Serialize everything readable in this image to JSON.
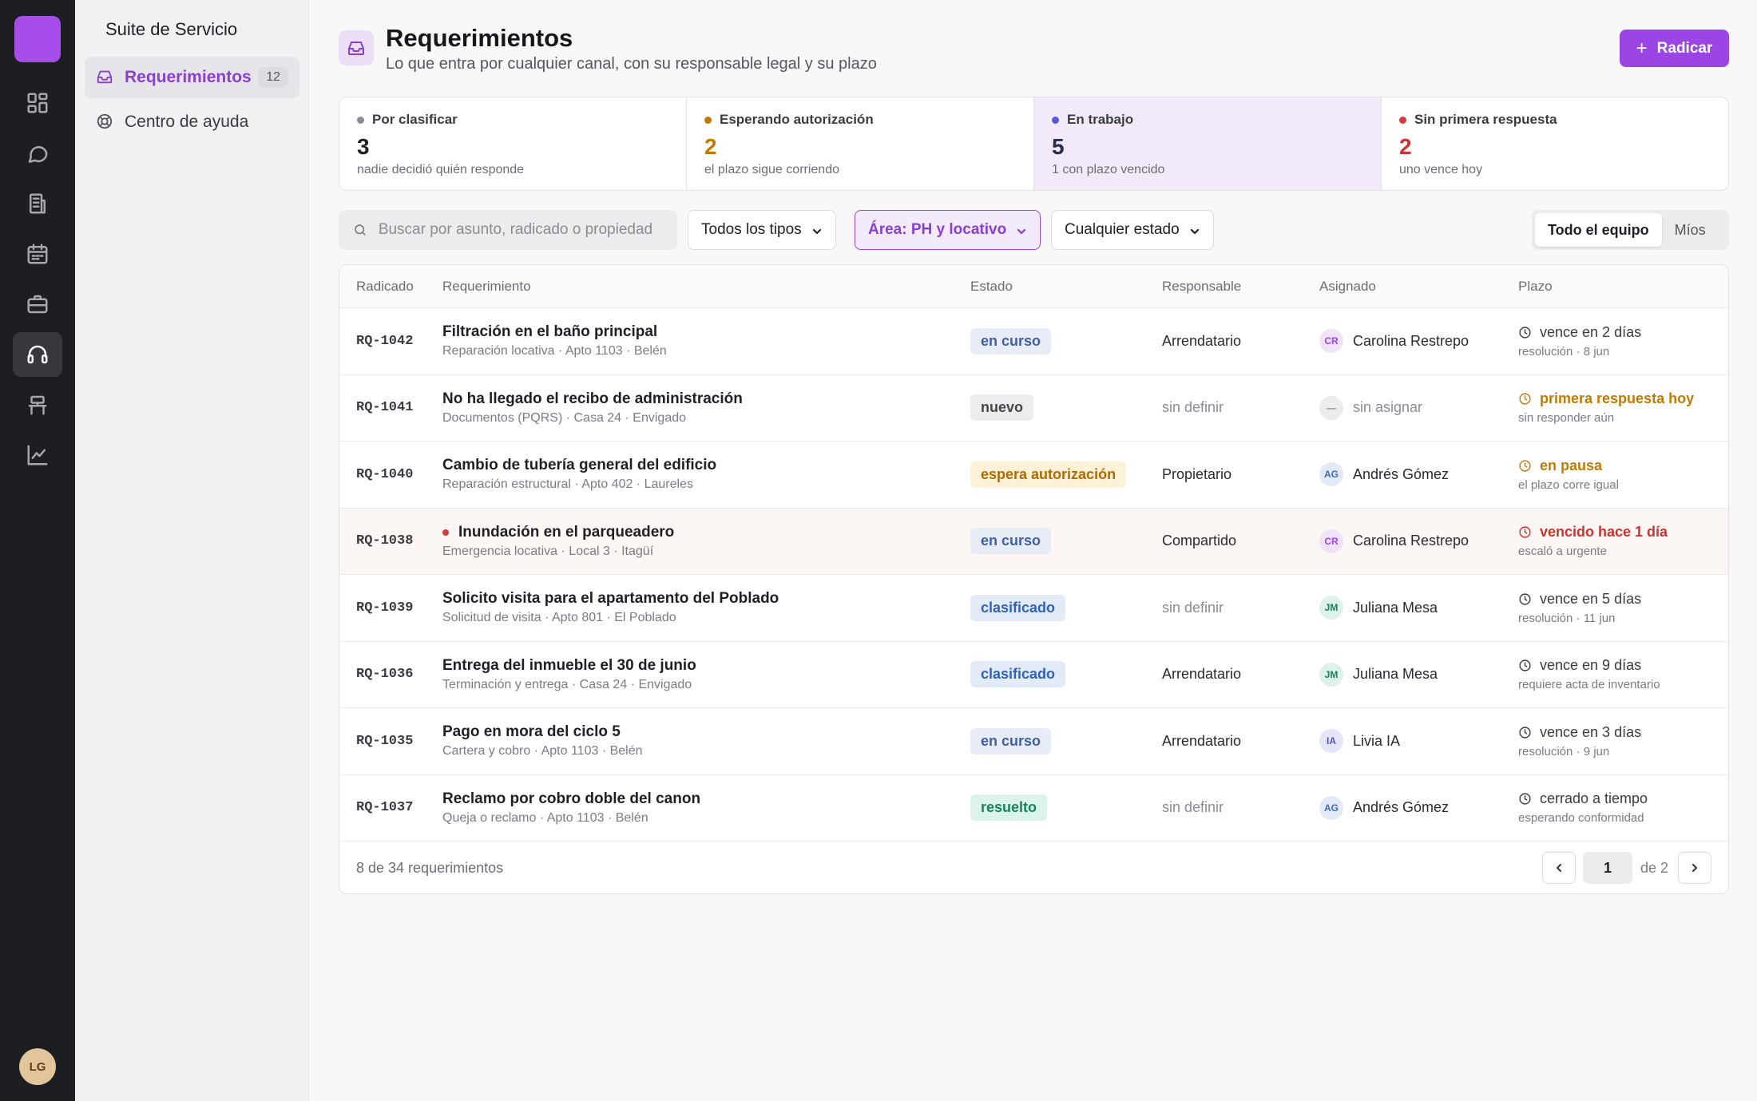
{
  "rail": {
    "brand_color": "#a64dea",
    "nav": [
      "dashboard-icon",
      "chat-icon",
      "building-icon",
      "calendar-icon",
      "briefcase-icon",
      "headset-icon",
      "desk-icon",
      "chart-icon"
    ],
    "active_nav": "headset-icon",
    "avatar": "LG"
  },
  "sidebar": {
    "title": "Suite de Servicio",
    "items": [
      {
        "label": "Requerimientos",
        "count": "12",
        "icon": "inbox-icon"
      },
      {
        "label": "Centro de ayuda",
        "icon": "lifebuoy-icon"
      }
    ]
  },
  "header": {
    "title": "Requerimientos",
    "subtitle": "Lo que entra por cualquier canal, con su responsable legal y su plazo",
    "primary_button": "Radicar"
  },
  "stats": [
    {
      "label": "Por clasificar",
      "value": "3",
      "note": "nadie decidió quién responde",
      "color": "#8a8c93"
    },
    {
      "label": "Esperando autorización",
      "value": "2",
      "note": "el plazo sigue corriendo",
      "color": "#c07a00"
    },
    {
      "label": "En trabajo",
      "value": "5",
      "note": "1 con plazo vencido",
      "color": "#5b57d6"
    },
    {
      "label": "Sin primera respuesta",
      "value": "2",
      "note": "uno vence hoy",
      "color": "#d43b3b"
    }
  ],
  "filters": {
    "search_placeholder": "Buscar por asunto, radicado o propiedad",
    "type": "Todos los tipos",
    "area": "Área: PH y locativo",
    "state": "Cualquier estado",
    "scope": [
      "Todo el equipo",
      "Míos"
    ]
  },
  "table": {
    "columns": [
      "Radicado",
      "Requerimiento",
      "Estado",
      "Responsable",
      "Asignado",
      "Plazo"
    ],
    "rows": [
      {
        "id": "RQ-1042",
        "title": "Filtración en el baño principal",
        "meta": "Reparación locativa · Apto 1103 · Belén",
        "status": "en curso",
        "responsible": "Arrendatario",
        "assignee": "Carolina Restrepo",
        "initials": "CR",
        "deadline": "vence en 2 días",
        "deadline_sub": "resolución · 8 jun"
      },
      {
        "id": "RQ-1041",
        "title": "No ha llegado el recibo de administración",
        "meta": "Documentos (PQRS) · Casa 24 · Envigado",
        "status": "nuevo",
        "responsible": "sin definir",
        "assignee": "sin asignar",
        "initials": "—",
        "deadline": "primera respuesta hoy",
        "deadline_sub": "sin responder aún"
      },
      {
        "id": "RQ-1040",
        "title": "Cambio de tubería general del edificio",
        "meta": "Reparación estructural · Apto 402 · Laureles",
        "status": "espera autorización",
        "responsible": "Propietario",
        "assignee": "Andrés Gómez",
        "initials": "AG",
        "deadline": "en pausa",
        "deadline_sub": "el plazo corre igual"
      },
      {
        "id": "RQ-1038",
        "title": "Inundación en el parqueadero",
        "meta": "Emergencia locativa · Local 3 · Itagüí",
        "status": "en curso",
        "responsible": "Compartido",
        "assignee": "Carolina Restrepo",
        "initials": "CR",
        "deadline": "vencido hace 1 día",
        "deadline_sub": "escaló a urgente"
      },
      {
        "id": "RQ-1039",
        "title": "Solicito visita para el apartamento del Poblado",
        "meta": "Solicitud de visita · Apto 801 · El Poblado",
        "status": "clasificado",
        "responsible": "sin definir",
        "assignee": "Juliana Mesa",
        "initials": "JM",
        "deadline": "vence en 5 días",
        "deadline_sub": "resolución · 11 jun"
      },
      {
        "id": "RQ-1036",
        "title": "Entrega del inmueble el 30 de junio",
        "meta": "Terminación y entrega · Casa 24 · Envigado",
        "status": "clasificado",
        "responsible": "Arrendatario",
        "assignee": "Juliana Mesa",
        "initials": "JM",
        "deadline": "vence en 9 días",
        "deadline_sub": "requiere acta de inventario"
      },
      {
        "id": "RQ-1035",
        "title": "Pago en mora del ciclo 5",
        "meta": "Cartera y cobro · Apto 1103 · Belén",
        "status": "en curso",
        "responsible": "Arrendatario",
        "assignee": "Livia IA",
        "initials": "IA",
        "deadline": "vence en 3 días",
        "deadline_sub": "resolución · 9 jun"
      },
      {
        "id": "RQ-1037",
        "title": "Reclamo por cobro doble del canon",
        "meta": "Queja o reclamo · Apto 1103 · Belén",
        "status": "resuelto",
        "responsible": "sin definir",
        "assignee": "Andrés Gómez",
        "initials": "AG",
        "deadline": "cerrado a tiempo",
        "deadline_sub": "esperando conformidad"
      }
    ],
    "footer_count": "8 de 34 requerimientos",
    "page": "1",
    "page_of": "de 2"
  }
}
